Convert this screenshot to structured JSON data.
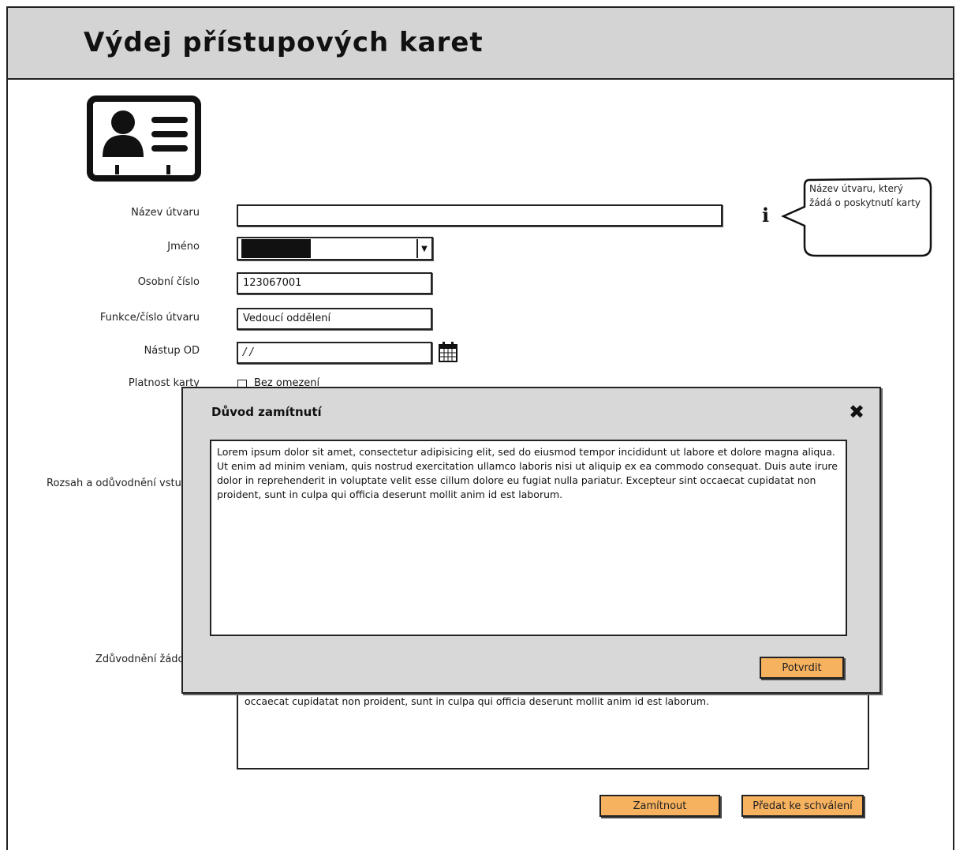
{
  "page": {
    "title": "Výdej přístupových karet"
  },
  "form": {
    "nazev_utvaru": {
      "label": "Název útvaru",
      "value": ""
    },
    "jmeno": {
      "label": "Jméno",
      "value": ""
    },
    "osobni_cislo": {
      "label": "Osobní číslo",
      "value": "123067001"
    },
    "funkce": {
      "label": "Funkce/číslo útvaru",
      "value": "Vedoucí oddělení"
    },
    "nastup": {
      "label": "Nástup OD",
      "value": "/ /"
    },
    "platnost": {
      "label": "Platnost karty",
      "checkbox_label": "Bez omezení",
      "checked": false
    },
    "rozsah": {
      "label": "Rozsah a odůvodnění vstupu"
    },
    "zduvodneni": {
      "label": "Zdůvodnění žádosti",
      "value": "occaecat cupidatat non proident, sunt in culpa qui officia deserunt mollit anim id est laborum."
    }
  },
  "tooltip": {
    "text": "Název útvaru, který žádá o poskytnutí karty"
  },
  "buttons": {
    "zamitnout": "Zamítnout",
    "predat": "Předat ke schválení"
  },
  "modal": {
    "title": "Důvod zamítnutí",
    "text": "Lorem ipsum dolor sit amet, consectetur adipisicing elit, sed do eiusmod tempor incididunt ut labore et dolore magna aliqua. Ut enim ad minim veniam, quis nostrud exercitation ullamco laboris nisi ut aliquip ex ea commodo consequat. Duis aute irure dolor in reprehenderit in voluptate velit esse cillum dolore eu fugiat nulla pariatur. Excepteur sint occaecat cupidatat non proident, sunt in culpa qui officia deserunt mollit anim id est laborum.",
    "confirm": "Potvrdit"
  },
  "icons": [
    "id-card-icon",
    "info-icon",
    "calendar-icon",
    "close-icon",
    "chevron-down-icon"
  ]
}
